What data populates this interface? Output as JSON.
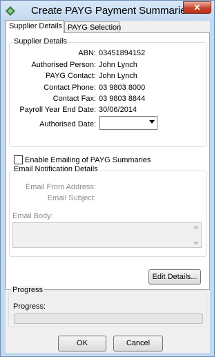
{
  "window": {
    "title": "Create PAYG Payment Summaries",
    "close_label": "✕",
    "icons": {
      "app": "app-logo-icon",
      "close": "close-icon"
    },
    "accent": "#c4d9ef"
  },
  "tabs": [
    {
      "label": "Supplier Details",
      "active": true
    },
    {
      "label": "PAYG Selection",
      "active": false
    }
  ],
  "supplier_details": {
    "group_title": "Supplier Details",
    "fields": [
      {
        "label": "ABN:",
        "value": "03451894152"
      },
      {
        "label": "Authorised Person:",
        "value": "John Lynch"
      },
      {
        "label": "PAYG Contact:",
        "value": "John Lynch"
      },
      {
        "label": "Contact Phone:",
        "value": "03 9803 8000"
      },
      {
        "label": "Contact Fax:",
        "value": "03 9803 8844"
      },
      {
        "label": "Payroll Year End Date:",
        "value": "30/06/2014"
      }
    ],
    "authorised_date_label": "Authorised Date:",
    "authorised_date_value": ""
  },
  "email": {
    "enable_label": "Enable Emailing of PAYG Summaries",
    "enabled": false,
    "group_title": "Email Notification Details",
    "from_label": "Email From Address:",
    "subject_label": "Email Subject:",
    "body_label": "Email Body:"
  },
  "edit_details_label": "Edit Details...",
  "progress": {
    "group_title": "Progress",
    "label": "Progress:",
    "value": 0
  },
  "buttons": {
    "ok": "OK",
    "cancel": "Cancel"
  }
}
